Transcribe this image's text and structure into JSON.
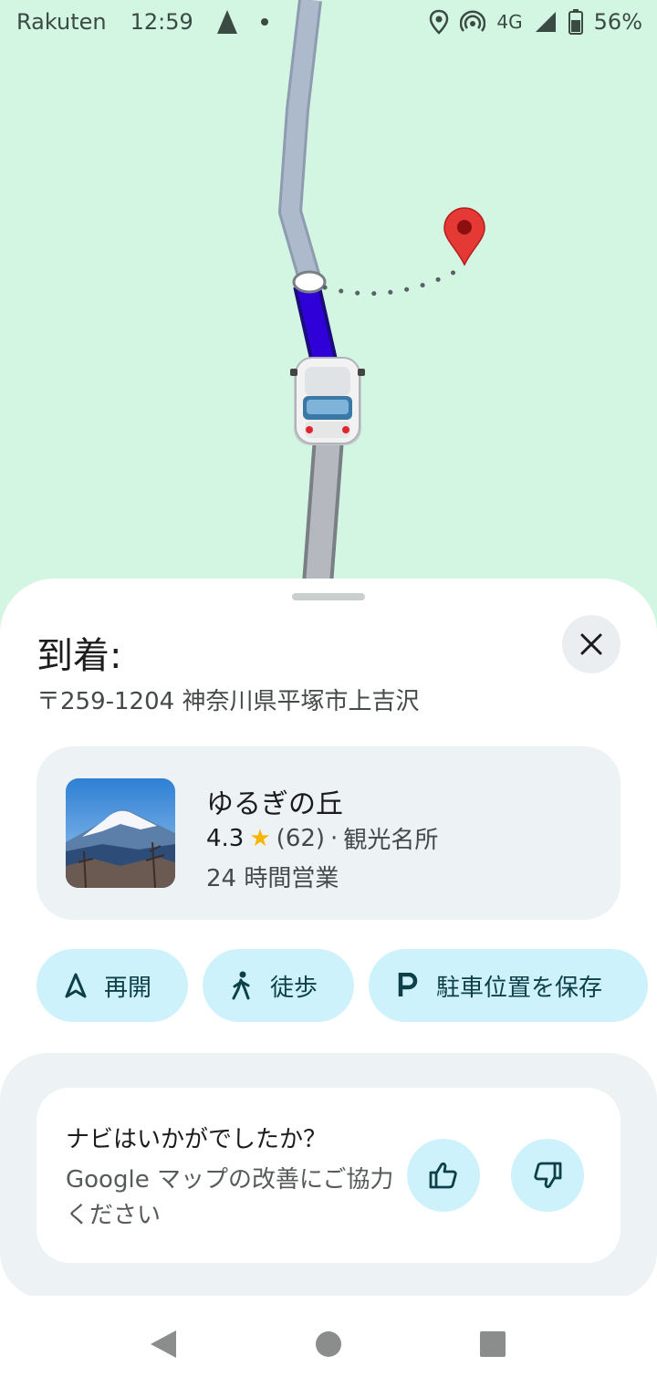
{
  "status_bar": {
    "carrier": "Rakuten",
    "time": "12:59",
    "network": "4G",
    "battery": "56%",
    "icons": [
      "navigation-icon",
      "notification-dot-icon",
      "location-icon",
      "hotspot-icon",
      "signal-icon",
      "battery-icon"
    ]
  },
  "map": {
    "icons": [
      "destination-pin-icon",
      "car-icon"
    ],
    "colors": {
      "background": "#d3f6e2",
      "route_active": "#2f00d8",
      "route_gray": "#a8b5c8",
      "pin": "#e53935"
    }
  },
  "arrival": {
    "title": "到着:",
    "address": "〒259-1204 神奈川県平塚市上吉沢",
    "close_icon": "close-icon"
  },
  "place": {
    "name": "ゆるぎの丘",
    "rating": "4.3",
    "star": "★",
    "reviews": "(62)",
    "separator": "·",
    "category": "観光名所",
    "hours": "24 時間営業",
    "photo": "mount-fuji-photo"
  },
  "actions": [
    {
      "label": "再開",
      "icon": "navigation-arrow-icon"
    },
    {
      "label": "徒歩",
      "icon": "walking-icon"
    },
    {
      "label": "駐車位置を保存",
      "icon": "parking-icon"
    }
  ],
  "feedback": {
    "question": "ナビはいかがでしたか？",
    "description": "Google マップの改善にご協力ください",
    "thumbs_up_icon": "thumbs-up-icon",
    "thumbs_down_icon": "thumbs-down-icon"
  },
  "nav_bar": {
    "icons": [
      "back-icon",
      "home-icon",
      "recents-icon"
    ]
  }
}
